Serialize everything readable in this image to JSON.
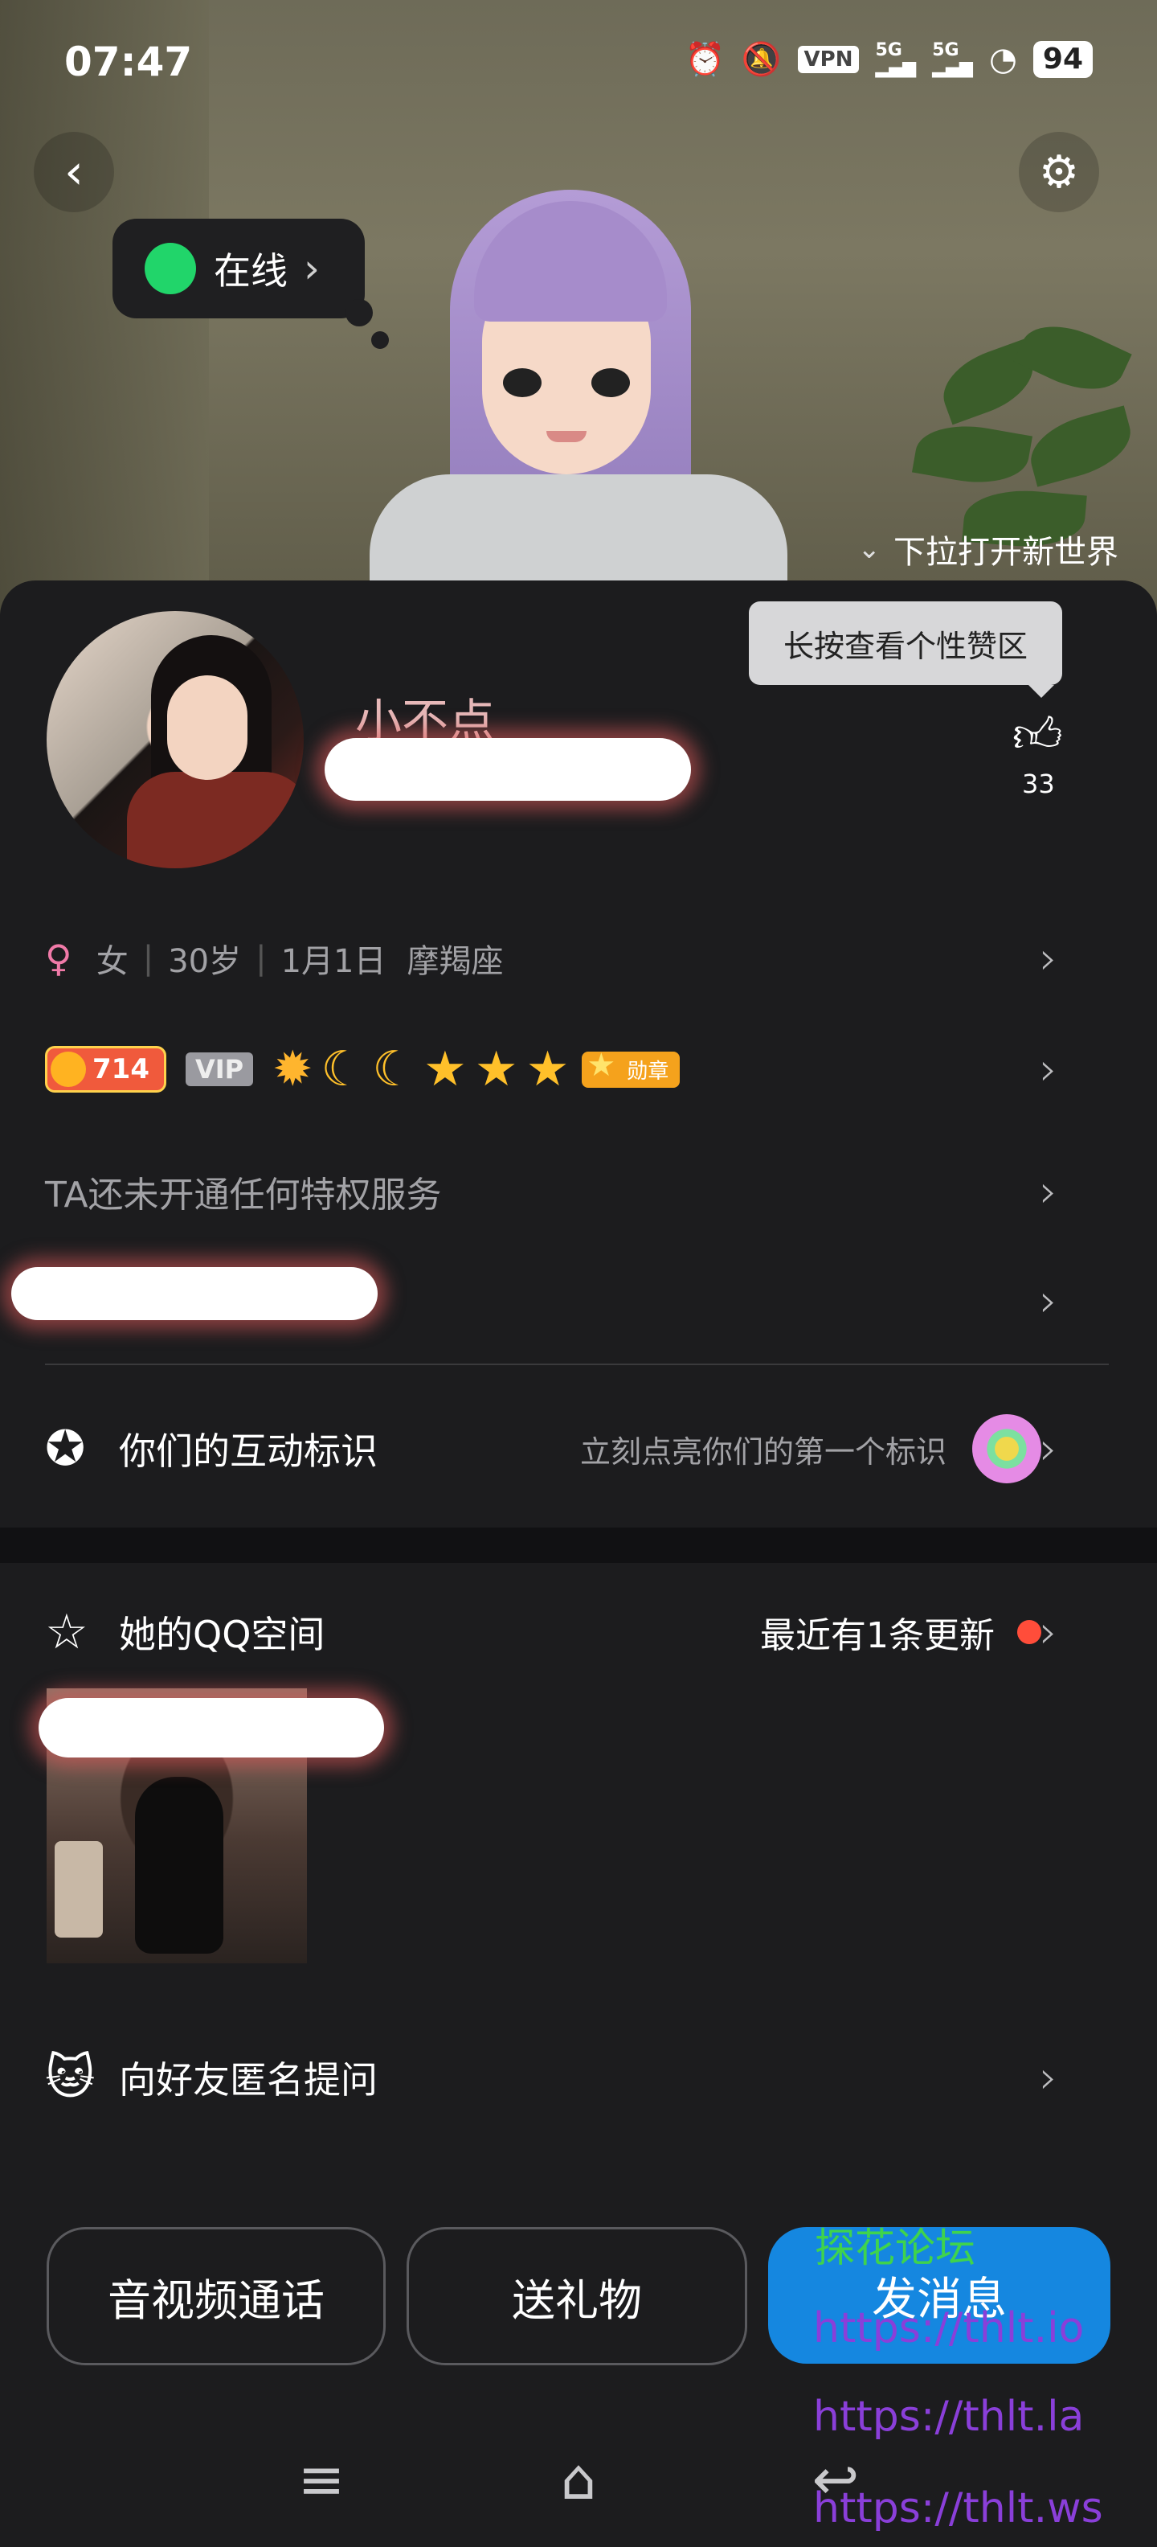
{
  "status_bar": {
    "time": "07:47",
    "vpn_label": "VPN",
    "sig1": "5G",
    "sig2": "5G",
    "battery": "94",
    "icons": [
      "alarm-icon",
      "mute-icon",
      "vpn-icon",
      "signal-icon",
      "signal-icon",
      "wifi-icon",
      "battery-icon"
    ]
  },
  "hero": {
    "online_label": "在线",
    "pull_hint": "下拉打开新世界"
  },
  "profile": {
    "nickname": "小不点",
    "tooltip": "长按查看个性赞区",
    "like_count": "33",
    "gender_symbol": "♀",
    "gender": "女",
    "age": "30岁",
    "birthday": "1月1日",
    "zodiac": "摩羯座",
    "level_badge": "714",
    "vip_label": "VIP",
    "medal_label": "勋章",
    "privilege_text": "TA还未开通任何特权服务"
  },
  "interaction": {
    "title": "你们的互动标识",
    "hint": "立刻点亮你们的第一个标识"
  },
  "qzone": {
    "title": "她的QQ空间",
    "update_text": "最近有1条更新"
  },
  "anon_question": {
    "title": "向好友匿名提问"
  },
  "actions": {
    "call": "音视频通话",
    "gift": "送礼物",
    "message": "发消息"
  },
  "watermarks": {
    "forum": "探花论坛",
    "url1": "https://thlt.io",
    "url2": "https://thlt.la",
    "url3": "https://thlt.ws"
  },
  "colors": {
    "online_dot": "#21d56a",
    "primary_button": "#1587e0",
    "update_dot": "#ff4d3a",
    "watermark_green": "#3fd34d",
    "watermark_purple": "#8a3fd9"
  }
}
